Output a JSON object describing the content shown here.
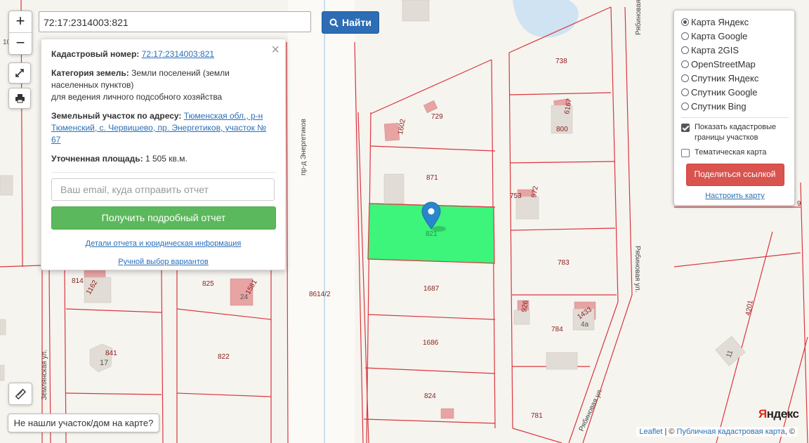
{
  "search": {
    "value": "72:17:2314003:821",
    "button_label": "Найти"
  },
  "zoom": {
    "in_label": "+",
    "out_label": "−"
  },
  "popup": {
    "cadastral_label": "Кадастровый номер:",
    "cadastral_value": "72:17:2314003:821",
    "category_label": "Категория земель:",
    "category_value": "Земли поселений (земли населенных пунктов)",
    "usage": "для ведения личного подсобного хозяйства",
    "address_label": "Земельный участок по адресу:",
    "address_value": "Тюменская обл., р-н Тюменский, с. Червишево, пр. Энергетиков, участок № 67",
    "area_label": "Уточненная площадь:",
    "area_value": "1 505 кв.м.",
    "email_placeholder": "Ваш email, куда отправить отчет",
    "report_button": "Получить подробный отчет",
    "details_link": "Детали отчета и юридическая информация",
    "manual_link": "Ручной выбор вариантов",
    "close": "×"
  },
  "layers": {
    "options": [
      {
        "label": "Карта Яндекс",
        "selected": true
      },
      {
        "label": "Карта Google",
        "selected": false
      },
      {
        "label": "Карта 2GIS",
        "selected": false
      },
      {
        "label": "OpenStreetMap",
        "selected": false
      },
      {
        "label": "Спутник Яндекс",
        "selected": false
      },
      {
        "label": "Спутник Google",
        "selected": false
      },
      {
        "label": "Спутник Bing",
        "selected": false
      }
    ],
    "show_boundaries": "Показать кадастровые границы участков",
    "show_boundaries_checked": true,
    "thematic": "Тематическая карта",
    "thematic_checked": false,
    "share_button": "Поделиться ссылкой",
    "configure_link": "Настроить карту"
  },
  "not_found": "Не нашли участок/дом на карте?",
  "attribution": {
    "leaflet": "Leaflet",
    "separator": " | © ",
    "pkk": "Публичная кадастровая карта",
    "suffix": ", ©"
  },
  "yandex_logo": {
    "first": "Я",
    "rest": "ндекс"
  },
  "map_labels": {
    "parcels": [
      "738",
      "729",
      "1602",
      "6167",
      "800",
      "871",
      "753",
      "972",
      "821",
      "783",
      "814",
      "1162",
      "825",
      "1581",
      "24",
      "8614/2",
      "1687",
      "926",
      "1433",
      "4а",
      "784",
      "1686",
      "841",
      "17",
      "822",
      "824",
      "781",
      "4201",
      "11",
      "9",
      "10"
    ],
    "streets": [
      "пр-д Энергетиков",
      "Рябиновая ул.",
      "Рябиновая ул.",
      "Рябиновая ул.",
      "Землянская ул."
    ]
  },
  "colors": {
    "selected_parcel": "#3cf57a",
    "boundary": "#d9363e",
    "building": "#e8a3a3",
    "primary": "#2d6db5",
    "success": "#5cb85c",
    "danger": "#d9534f"
  }
}
